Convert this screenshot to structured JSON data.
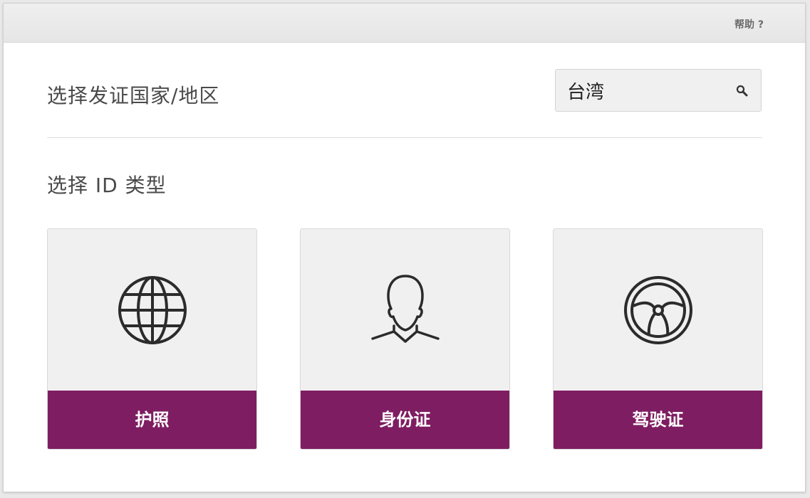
{
  "header": {
    "help_label": "帮助 ?"
  },
  "country_section": {
    "title": "选择发证国家/地区",
    "search_value": "台湾"
  },
  "id_type_section": {
    "title": "选择 ID 类型",
    "cards": [
      {
        "label": "护照",
        "icon": "globe-icon"
      },
      {
        "label": "身份证",
        "icon": "person-icon"
      },
      {
        "label": "驾驶证",
        "icon": "steering-wheel-icon"
      }
    ]
  },
  "colors": {
    "accent": "#7f1d62",
    "card_bg": "#f0f0f0",
    "topbar_bg": "#eaeaea"
  }
}
